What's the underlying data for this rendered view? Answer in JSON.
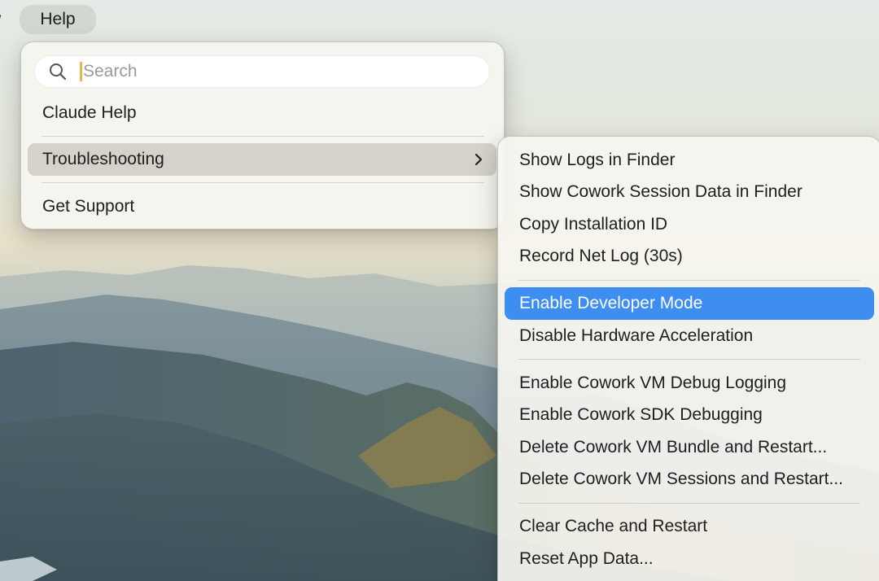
{
  "menubar": {
    "view_partial": "w",
    "help_label": "Help"
  },
  "help_menu": {
    "search_placeholder": "Search",
    "items": [
      {
        "label": "Claude Help"
      },
      {
        "label": "Troubleshooting"
      },
      {
        "label": "Get Support"
      }
    ]
  },
  "troubleshooting_submenu": {
    "items": [
      {
        "label": "Show Logs in Finder"
      },
      {
        "label": "Show Cowork Session Data in Finder"
      },
      {
        "label": "Copy Installation ID"
      },
      {
        "label": "Record Net Log (30s)"
      },
      {
        "label": "Enable Developer Mode"
      },
      {
        "label": "Disable Hardware Acceleration"
      },
      {
        "label": "Enable Cowork VM Debug Logging"
      },
      {
        "label": "Enable Cowork SDK Debugging"
      },
      {
        "label": "Delete Cowork VM Bundle and Restart..."
      },
      {
        "label": "Delete Cowork VM Sessions and Restart..."
      },
      {
        "label": "Clear Cache and Restart"
      },
      {
        "label": "Reset App Data..."
      }
    ]
  },
  "colors": {
    "highlight_blue": "#3d8ef0",
    "caret": "#e3b64a"
  }
}
